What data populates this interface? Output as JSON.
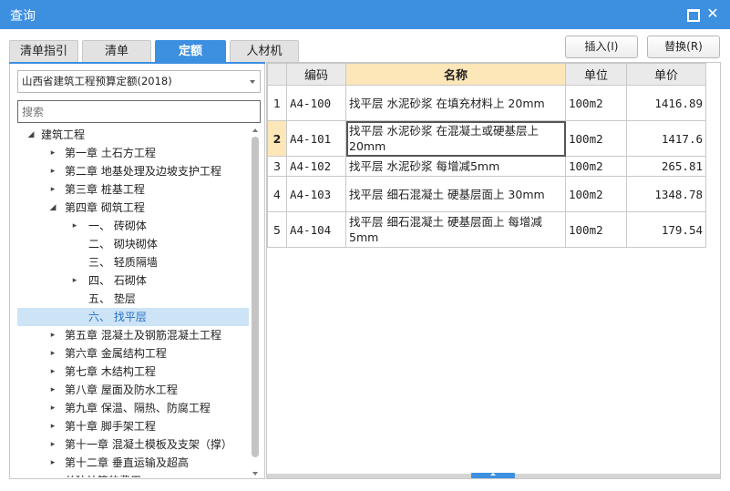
{
  "window": {
    "title": "查询"
  },
  "tabs": [
    {
      "label": "清单指引",
      "active": false
    },
    {
      "label": "清单",
      "active": false
    },
    {
      "label": "定额",
      "active": true
    },
    {
      "label": "人材机",
      "active": false
    }
  ],
  "toolbar": {
    "insert_label": "插入(I)",
    "replace_label": "替换(R)"
  },
  "left": {
    "library_select": "山西省建筑工程预算定额(2018)",
    "search_placeholder": "搜索",
    "tree": [
      {
        "label": "建筑工程",
        "level": 0,
        "toggle": "◢",
        "selected": false
      },
      {
        "label": "第一章 土石方工程",
        "level": 1,
        "toggle": "▸",
        "selected": false
      },
      {
        "label": "第二章 地基处理及边坡支护工程",
        "level": 1,
        "toggle": "▸",
        "selected": false
      },
      {
        "label": "第三章 桩基工程",
        "level": 1,
        "toggle": "▸",
        "selected": false
      },
      {
        "label": "第四章 砌筑工程",
        "level": 1,
        "toggle": "◢",
        "selected": false
      },
      {
        "label": "一、 砖砌体",
        "level": 2,
        "toggle": "▸",
        "selected": false
      },
      {
        "label": "二、 砌块砌体",
        "level": 2,
        "toggle": "",
        "selected": false
      },
      {
        "label": "三、 轻质隔墙",
        "level": 2,
        "toggle": "",
        "selected": false
      },
      {
        "label": "四、 石砌体",
        "level": 2,
        "toggle": "▸",
        "selected": false
      },
      {
        "label": "五、 垫层",
        "level": 2,
        "toggle": "",
        "selected": false
      },
      {
        "label": "六、 找平层",
        "level": 2,
        "toggle": "",
        "selected": true
      },
      {
        "label": "第五章 混凝土及钢筋混凝土工程",
        "level": 1,
        "toggle": "▸",
        "selected": false
      },
      {
        "label": "第六章 金属结构工程",
        "level": 1,
        "toggle": "▸",
        "selected": false
      },
      {
        "label": "第七章 木结构工程",
        "level": 1,
        "toggle": "▸",
        "selected": false
      },
      {
        "label": "第八章 屋面及防水工程",
        "level": 1,
        "toggle": "▸",
        "selected": false
      },
      {
        "label": "第九章 保温、隔热、防腐工程",
        "level": 1,
        "toggle": "▸",
        "selected": false
      },
      {
        "label": "第十章 脚手架工程",
        "level": 1,
        "toggle": "▸",
        "selected": false
      },
      {
        "label": "第十一章 混凝土模板及支架（撑）",
        "level": 1,
        "toggle": "▸",
        "selected": false
      },
      {
        "label": "第十二章 垂直运输及超高",
        "level": 1,
        "toggle": "▸",
        "selected": false
      },
      {
        "label": "单独计算的费用",
        "level": 1,
        "toggle": "",
        "selected": false
      }
    ]
  },
  "grid": {
    "headers": {
      "code": "编码",
      "name": "名称",
      "unit": "单位",
      "price": "单价"
    },
    "rows": [
      {
        "num": "1",
        "code": "A4-100",
        "name": "找平层 水泥砂浆 在填充材料上 20mm",
        "unit": "100m2",
        "price": "1416.89"
      },
      {
        "num": "2",
        "code": "A4-101",
        "name": "找平层 水泥砂浆 在混凝土或硬基层上 20mm",
        "unit": "100m2",
        "price": "1417.6"
      },
      {
        "num": "3",
        "code": "A4-102",
        "name": "找平层 水泥砂浆 每增减5mm",
        "unit": "100m2",
        "price": "265.81"
      },
      {
        "num": "4",
        "code": "A4-103",
        "name": "找平层 细石混凝土 硬基层面上 30mm",
        "unit": "100m2",
        "price": "1348.78"
      },
      {
        "num": "5",
        "code": "A4-104",
        "name": "找平层 细石混凝土 硬基层面上 每增减5mm",
        "unit": "100m2",
        "price": "179.54"
      }
    ]
  },
  "colors": {
    "accent": "#3d8fe0",
    "header_highlight": "#fde6b8",
    "tree_selected": "#cde4f7"
  }
}
